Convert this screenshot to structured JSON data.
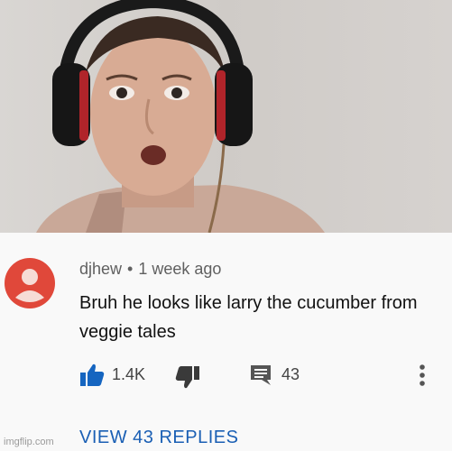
{
  "comment": {
    "username": "djhew",
    "separator": "•",
    "time": "1 week ago",
    "text": "Bruh he looks like larry the cucumber from veggie tales",
    "likes": "1.4K",
    "replies_count": "43",
    "view_replies": "VIEW 43 REPLIES"
  },
  "watermark": "imgflip.com",
  "colors": {
    "avatar": "#e0483a",
    "link": "#1a5fb4",
    "like_icon": "#1565c0"
  },
  "icons": {
    "avatar": "person-icon",
    "like": "thumbs-up-icon",
    "dislike": "thumbs-down-icon",
    "reply": "comment-icon",
    "menu": "more-vert-icon"
  }
}
